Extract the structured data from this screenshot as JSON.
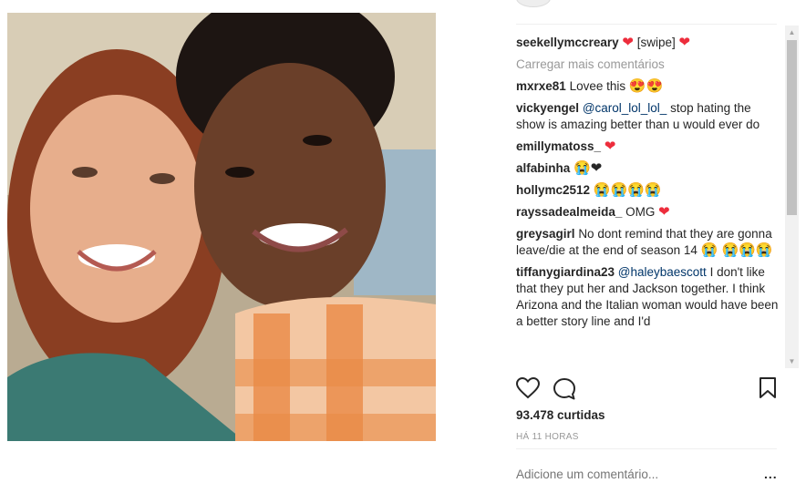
{
  "post": {
    "author": "seekellymccreary",
    "caption": "[swipe]",
    "load_more": "Carregar mais comentários",
    "likes": "93.478 curtidas",
    "time": "HÁ 11 HORAS",
    "add_comment_placeholder": "Adicione um comentário...",
    "more_options": "..."
  },
  "comments": [
    {
      "user": "mxrxe81",
      "text": "Lovee this",
      "emoji": "😍😍"
    },
    {
      "user": "vickyengel",
      "mention": "@carol_lol_lol_",
      "text": " stop hating the show is amazing better than u would ever do",
      "emoji": ""
    },
    {
      "user": "emillymatoss_",
      "text": "",
      "emoji": "❤"
    },
    {
      "user": "alfabinha",
      "text": "",
      "emoji": "😭❤"
    },
    {
      "user": "hollymc2512",
      "text": "",
      "emoji": "😭😭😭😭"
    },
    {
      "user": "rayssadealmeida_",
      "text": "OMG",
      "emoji": "❤"
    },
    {
      "user": "greysagirl",
      "text": "No dont remind that they are gonna leave/die at the end of season 14",
      "emoji": "😭 😭😭😭"
    },
    {
      "user": "tiffanygiardina23",
      "mention": "@haleybaescott",
      "text": " I don't like that they put her and Jackson together. I think Arizona and the Italian woman would have been a better story line and I'd",
      "emoji": ""
    }
  ],
  "colors": {
    "heart": "#ed2d3c",
    "muted": "#999999",
    "text": "#262626"
  }
}
